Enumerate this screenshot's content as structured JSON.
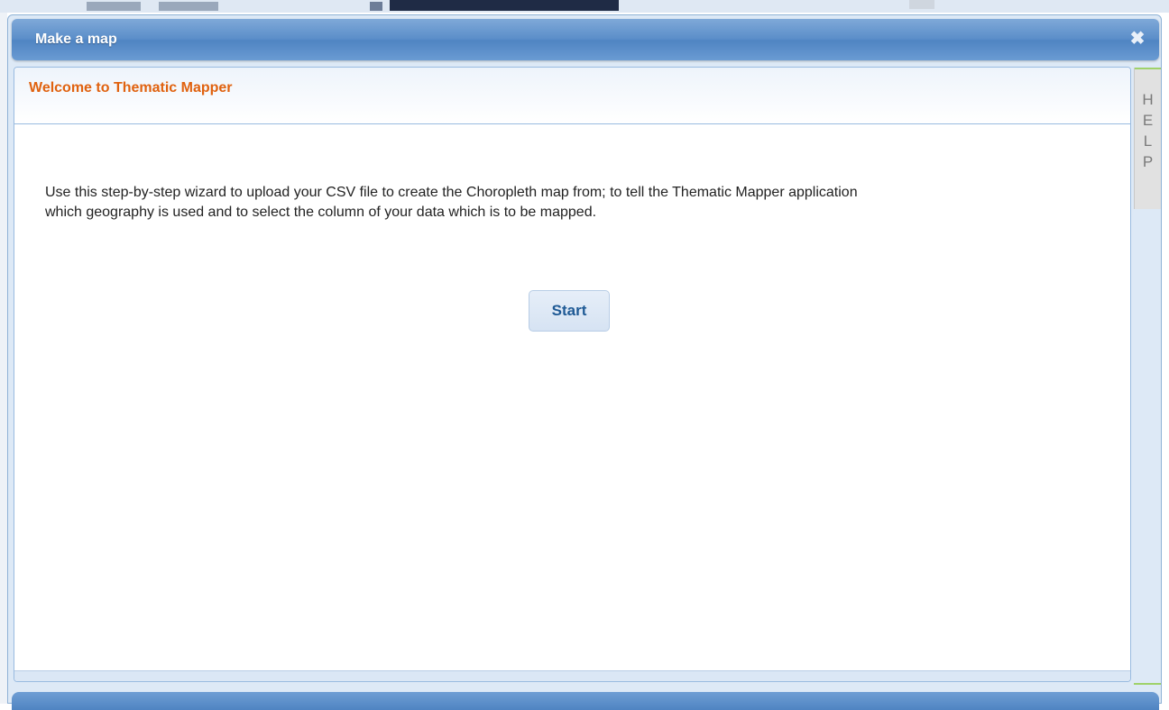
{
  "dialog": {
    "title": "Make a map",
    "close_icon": "close-icon"
  },
  "panel": {
    "title": "Welcome to Thematic Mapper",
    "intro_line1": "Use this step-by-step wizard to upload your CSV file to create the Choropleth map from; to tell the Thematic Mapper application",
    "intro_line2": "which geography is used and to select the column of your data which is to be mapped.",
    "start_label": "Start"
  },
  "help_tab": {
    "letters": [
      "H",
      "E",
      "L",
      "P"
    ]
  },
  "colors": {
    "title_bar": "#5b8ec9",
    "panel_title": "#e0620f",
    "start_text": "#1f5a95"
  }
}
